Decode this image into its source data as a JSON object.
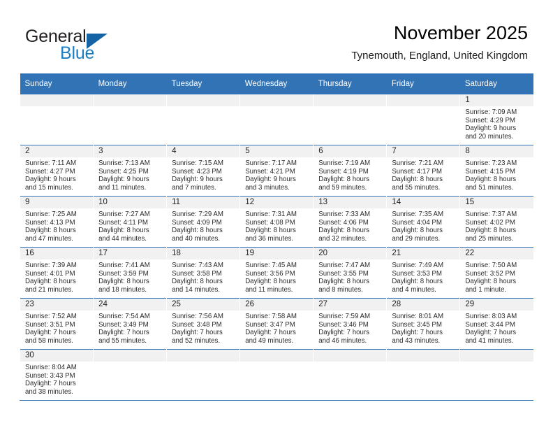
{
  "brand": {
    "logo_word_1": "General",
    "logo_word_2": "Blue",
    "triangle_icon": "blue-triangle-icon",
    "accent_color": "#3273b5",
    "logo_blue": "#1c7fc4"
  },
  "header": {
    "title": "November 2025",
    "subtitle": "Tynemouth, England, United Kingdom"
  },
  "calendar": {
    "weekdays": [
      "Sunday",
      "Monday",
      "Tuesday",
      "Wednesday",
      "Thursday",
      "Friday",
      "Saturday"
    ],
    "weeks": [
      [
        {
          "day": "",
          "empty": true
        },
        {
          "day": "",
          "empty": true
        },
        {
          "day": "",
          "empty": true
        },
        {
          "day": "",
          "empty": true
        },
        {
          "day": "",
          "empty": true
        },
        {
          "day": "",
          "empty": true
        },
        {
          "day": "1",
          "sunrise": "Sunrise: 7:09 AM",
          "sunset": "Sunset: 4:29 PM",
          "daylight_1": "Daylight: 9 hours",
          "daylight_2": "and 20 minutes."
        }
      ],
      [
        {
          "day": "2",
          "sunrise": "Sunrise: 7:11 AM",
          "sunset": "Sunset: 4:27 PM",
          "daylight_1": "Daylight: 9 hours",
          "daylight_2": "and 15 minutes."
        },
        {
          "day": "3",
          "sunrise": "Sunrise: 7:13 AM",
          "sunset": "Sunset: 4:25 PM",
          "daylight_1": "Daylight: 9 hours",
          "daylight_2": "and 11 minutes."
        },
        {
          "day": "4",
          "sunrise": "Sunrise: 7:15 AM",
          "sunset": "Sunset: 4:23 PM",
          "daylight_1": "Daylight: 9 hours",
          "daylight_2": "and 7 minutes."
        },
        {
          "day": "5",
          "sunrise": "Sunrise: 7:17 AM",
          "sunset": "Sunset: 4:21 PM",
          "daylight_1": "Daylight: 9 hours",
          "daylight_2": "and 3 minutes."
        },
        {
          "day": "6",
          "sunrise": "Sunrise: 7:19 AM",
          "sunset": "Sunset: 4:19 PM",
          "daylight_1": "Daylight: 8 hours",
          "daylight_2": "and 59 minutes."
        },
        {
          "day": "7",
          "sunrise": "Sunrise: 7:21 AM",
          "sunset": "Sunset: 4:17 PM",
          "daylight_1": "Daylight: 8 hours",
          "daylight_2": "and 55 minutes."
        },
        {
          "day": "8",
          "sunrise": "Sunrise: 7:23 AM",
          "sunset": "Sunset: 4:15 PM",
          "daylight_1": "Daylight: 8 hours",
          "daylight_2": "and 51 minutes."
        }
      ],
      [
        {
          "day": "9",
          "sunrise": "Sunrise: 7:25 AM",
          "sunset": "Sunset: 4:13 PM",
          "daylight_1": "Daylight: 8 hours",
          "daylight_2": "and 47 minutes."
        },
        {
          "day": "10",
          "sunrise": "Sunrise: 7:27 AM",
          "sunset": "Sunset: 4:11 PM",
          "daylight_1": "Daylight: 8 hours",
          "daylight_2": "and 44 minutes."
        },
        {
          "day": "11",
          "sunrise": "Sunrise: 7:29 AM",
          "sunset": "Sunset: 4:09 PM",
          "daylight_1": "Daylight: 8 hours",
          "daylight_2": "and 40 minutes."
        },
        {
          "day": "12",
          "sunrise": "Sunrise: 7:31 AM",
          "sunset": "Sunset: 4:08 PM",
          "daylight_1": "Daylight: 8 hours",
          "daylight_2": "and 36 minutes."
        },
        {
          "day": "13",
          "sunrise": "Sunrise: 7:33 AM",
          "sunset": "Sunset: 4:06 PM",
          "daylight_1": "Daylight: 8 hours",
          "daylight_2": "and 32 minutes."
        },
        {
          "day": "14",
          "sunrise": "Sunrise: 7:35 AM",
          "sunset": "Sunset: 4:04 PM",
          "daylight_1": "Daylight: 8 hours",
          "daylight_2": "and 29 minutes."
        },
        {
          "day": "15",
          "sunrise": "Sunrise: 7:37 AM",
          "sunset": "Sunset: 4:02 PM",
          "daylight_1": "Daylight: 8 hours",
          "daylight_2": "and 25 minutes."
        }
      ],
      [
        {
          "day": "16",
          "sunrise": "Sunrise: 7:39 AM",
          "sunset": "Sunset: 4:01 PM",
          "daylight_1": "Daylight: 8 hours",
          "daylight_2": "and 21 minutes."
        },
        {
          "day": "17",
          "sunrise": "Sunrise: 7:41 AM",
          "sunset": "Sunset: 3:59 PM",
          "daylight_1": "Daylight: 8 hours",
          "daylight_2": "and 18 minutes."
        },
        {
          "day": "18",
          "sunrise": "Sunrise: 7:43 AM",
          "sunset": "Sunset: 3:58 PM",
          "daylight_1": "Daylight: 8 hours",
          "daylight_2": "and 14 minutes."
        },
        {
          "day": "19",
          "sunrise": "Sunrise: 7:45 AM",
          "sunset": "Sunset: 3:56 PM",
          "daylight_1": "Daylight: 8 hours",
          "daylight_2": "and 11 minutes."
        },
        {
          "day": "20",
          "sunrise": "Sunrise: 7:47 AM",
          "sunset": "Sunset: 3:55 PM",
          "daylight_1": "Daylight: 8 hours",
          "daylight_2": "and 8 minutes."
        },
        {
          "day": "21",
          "sunrise": "Sunrise: 7:49 AM",
          "sunset": "Sunset: 3:53 PM",
          "daylight_1": "Daylight: 8 hours",
          "daylight_2": "and 4 minutes."
        },
        {
          "day": "22",
          "sunrise": "Sunrise: 7:50 AM",
          "sunset": "Sunset: 3:52 PM",
          "daylight_1": "Daylight: 8 hours",
          "daylight_2": "and 1 minute."
        }
      ],
      [
        {
          "day": "23",
          "sunrise": "Sunrise: 7:52 AM",
          "sunset": "Sunset: 3:51 PM",
          "daylight_1": "Daylight: 7 hours",
          "daylight_2": "and 58 minutes."
        },
        {
          "day": "24",
          "sunrise": "Sunrise: 7:54 AM",
          "sunset": "Sunset: 3:49 PM",
          "daylight_1": "Daylight: 7 hours",
          "daylight_2": "and 55 minutes."
        },
        {
          "day": "25",
          "sunrise": "Sunrise: 7:56 AM",
          "sunset": "Sunset: 3:48 PM",
          "daylight_1": "Daylight: 7 hours",
          "daylight_2": "and 52 minutes."
        },
        {
          "day": "26",
          "sunrise": "Sunrise: 7:58 AM",
          "sunset": "Sunset: 3:47 PM",
          "daylight_1": "Daylight: 7 hours",
          "daylight_2": "and 49 minutes."
        },
        {
          "day": "27",
          "sunrise": "Sunrise: 7:59 AM",
          "sunset": "Sunset: 3:46 PM",
          "daylight_1": "Daylight: 7 hours",
          "daylight_2": "and 46 minutes."
        },
        {
          "day": "28",
          "sunrise": "Sunrise: 8:01 AM",
          "sunset": "Sunset: 3:45 PM",
          "daylight_1": "Daylight: 7 hours",
          "daylight_2": "and 43 minutes."
        },
        {
          "day": "29",
          "sunrise": "Sunrise: 8:03 AM",
          "sunset": "Sunset: 3:44 PM",
          "daylight_1": "Daylight: 7 hours",
          "daylight_2": "and 41 minutes."
        }
      ],
      [
        {
          "day": "30",
          "sunrise": "Sunrise: 8:04 AM",
          "sunset": "Sunset: 3:43 PM",
          "daylight_1": "Daylight: 7 hours",
          "daylight_2": "and 38 minutes."
        },
        {
          "day": "",
          "empty": true
        },
        {
          "day": "",
          "empty": true
        },
        {
          "day": "",
          "empty": true
        },
        {
          "day": "",
          "empty": true
        },
        {
          "day": "",
          "empty": true
        },
        {
          "day": "",
          "empty": true
        }
      ]
    ]
  }
}
